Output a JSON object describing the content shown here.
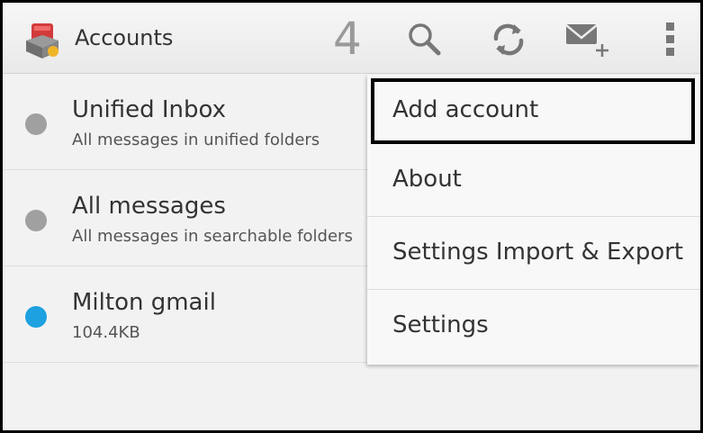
{
  "action_bar": {
    "title": "Accounts",
    "unread_count": "4",
    "icons": [
      "app-icon",
      "search-icon",
      "refresh-icon",
      "compose-icon",
      "overflow-menu-icon"
    ]
  },
  "accounts": [
    {
      "name": "Unified Inbox",
      "description": "All messages in unified folders",
      "dot_color": "#a0a0a0"
    },
    {
      "name": "All messages",
      "description": "All messages in searchable folders",
      "dot_color": "#a0a0a0"
    },
    {
      "name": "Milton gmail",
      "description": "104.4KB",
      "dot_color": "#1da1e0"
    }
  ],
  "menu": {
    "items": [
      "Add account",
      "About",
      "Settings Import & Export",
      "Settings"
    ],
    "highlighted": "Add account"
  },
  "colors": {
    "accent": "#1da1e0",
    "highlight_border": "#000000"
  }
}
